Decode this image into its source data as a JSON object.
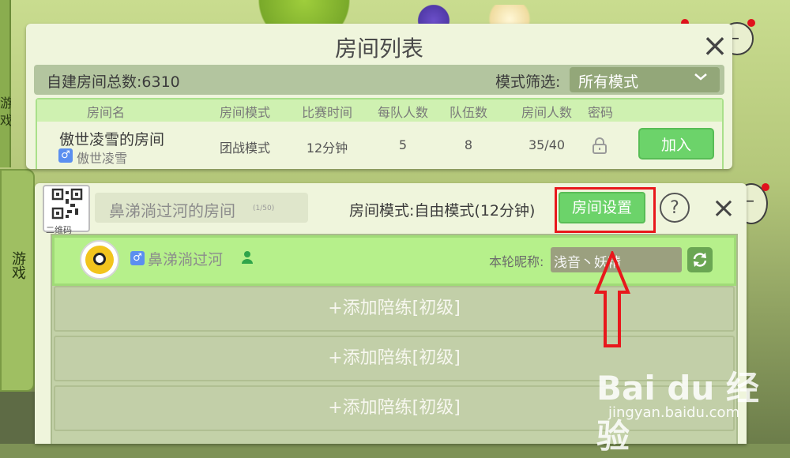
{
  "room_list": {
    "title": "房间列表",
    "close_icon": "×",
    "total_label": "自建房间总数:6310",
    "filter_label": "模式筛选:",
    "filter_value": "所有模式",
    "filter_icon": "chevron-down-icon",
    "columns": [
      "房间名",
      "房间模式",
      "比赛时间",
      "每队人数",
      "队伍数",
      "房间人数",
      "密码"
    ],
    "rows": [
      {
        "name": "傲世凌雪的房间",
        "owner_gender": "♂",
        "owner": "傲世凌雪",
        "mode": "团战模式",
        "time": "12分钟",
        "per_team": "5",
        "teams": "8",
        "players": "35/40",
        "password_icon": "lock-icon",
        "join_label": "加入"
      }
    ]
  },
  "room": {
    "qr_label": "二维码",
    "name": "鼻涕淌过河的房间",
    "count": "(1/50)",
    "mode_label": "房间模式:自由模式(12分钟)",
    "settings_label": "房间设置",
    "help_label": "?",
    "close_icon": "×",
    "player": {
      "gender": "♂",
      "name": "鼻涕淌过河",
      "nick_label": "本轮昵称:",
      "nick_value": "浅音丶妖精"
    },
    "slots": [
      "+添加陪练[初级]",
      "+添加陪练[初级]",
      "+添加陪练[初级]"
    ]
  },
  "side": {
    "top_label": "游戏",
    "bottom_label": "游戏"
  },
  "watermark": {
    "logo": "Bai du 经验",
    "url": "jingyan.baidu.com"
  },
  "colors": {
    "accent_green": "#6cd36a",
    "highlight_red": "#e8181c",
    "badge_blue": "#5b8ff0"
  }
}
